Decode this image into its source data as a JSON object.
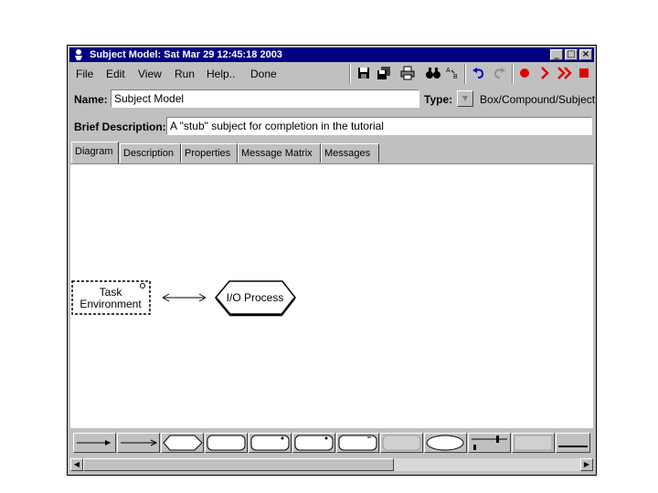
{
  "window": {
    "title": "Subject Model: Sat Mar 29 12:45:18 2003",
    "controls": [
      "_",
      "□",
      "×"
    ]
  },
  "menu": [
    "File",
    "Edit",
    "View",
    "Run",
    "Help..",
    "Done"
  ],
  "toolbar_icons": [
    "save-icon",
    "save-all-icon",
    "print-icon",
    "find-icon",
    "replace-icon",
    "undo-icon",
    "redo-icon",
    "record-icon",
    "step-icon",
    "fast-forward-icon",
    "stop-icon"
  ],
  "colors": {
    "titlebar": "#000080",
    "run_red": "#e00000",
    "undo_blue": "#0000c0"
  },
  "form": {
    "name_label": "Name:",
    "name_value": "Subject Model",
    "type_label": "Type:",
    "type_value": "Box/Compound/Subject",
    "desc_label": "Brief Description:",
    "desc_value": "A \"stub\" subject for completion in the tutorial"
  },
  "tabs": [
    "Diagram",
    "Description",
    "Properties",
    "Message Matrix",
    "Messages"
  ],
  "active_tab": "Diagram",
  "diagram": {
    "task_environment": [
      "Task",
      "Environment"
    ],
    "io_process": "I/O Process"
  },
  "palette": [
    "line-arrow-tool",
    "arrow-tool",
    "hexagon-tool",
    "rounded-box-tool",
    "rounded-box-alt-tool",
    "rounded-box-2-tool",
    "rounded-box-3-tool",
    "disabled-box-tool",
    "ellipse-tool",
    "connector-tool",
    "disabled-box-2-tool",
    "line-tool"
  ]
}
